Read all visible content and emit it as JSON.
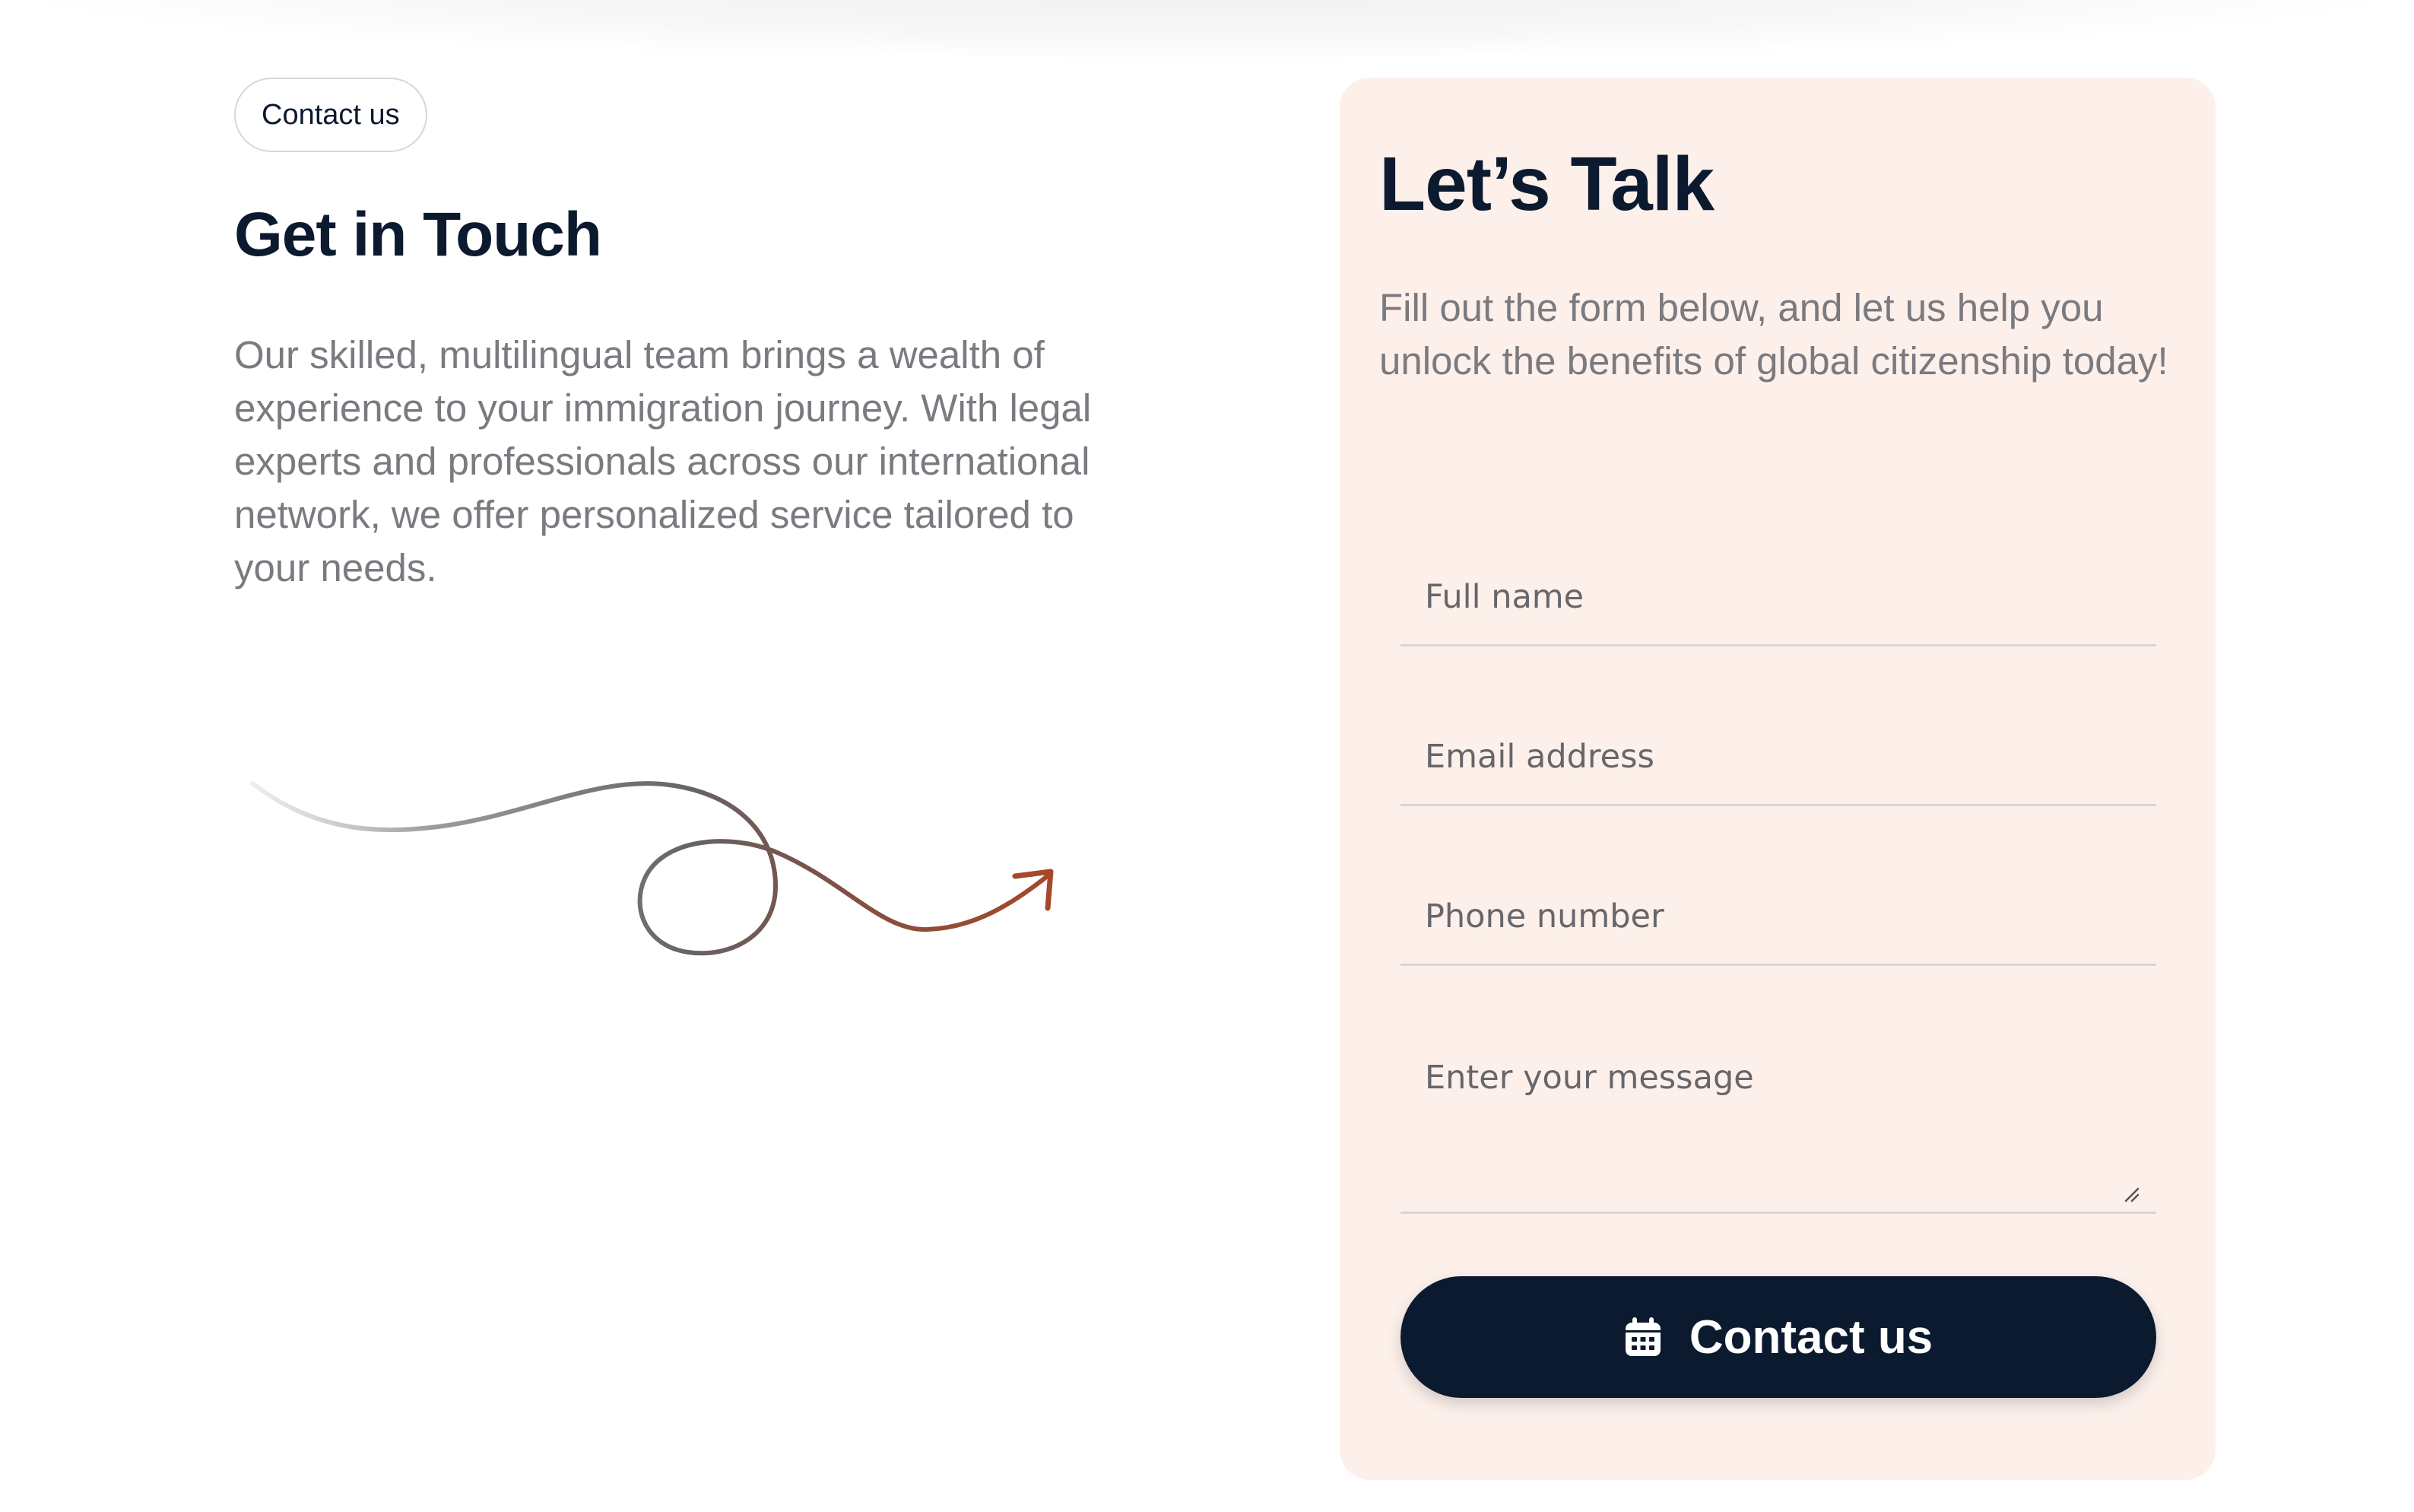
{
  "left": {
    "tag": "Contact us",
    "heading": "Get in Touch",
    "intro": "Our skilled, multilingual team brings a wealth of experience to your immigration journey. With legal experts and professionals across our international network, we offer personalized service tailored to your needs."
  },
  "card": {
    "title": "Let’s Talk",
    "subtitle": "Fill out the form below, and let us help you unlock the benefits of global citizenship today!",
    "fields": {
      "name_placeholder": "Full name",
      "email_placeholder": "Email address",
      "phone_placeholder": "Phone number",
      "message_placeholder": "Enter your message"
    },
    "submit_label": "Contact us",
    "submit_icon": "calendar-icon"
  },
  "colors": {
    "navy": "#0b1a2e",
    "card_bg": "#fdf0ea",
    "body_text": "#7a7a80",
    "arrow_accent": "#a6482a"
  }
}
